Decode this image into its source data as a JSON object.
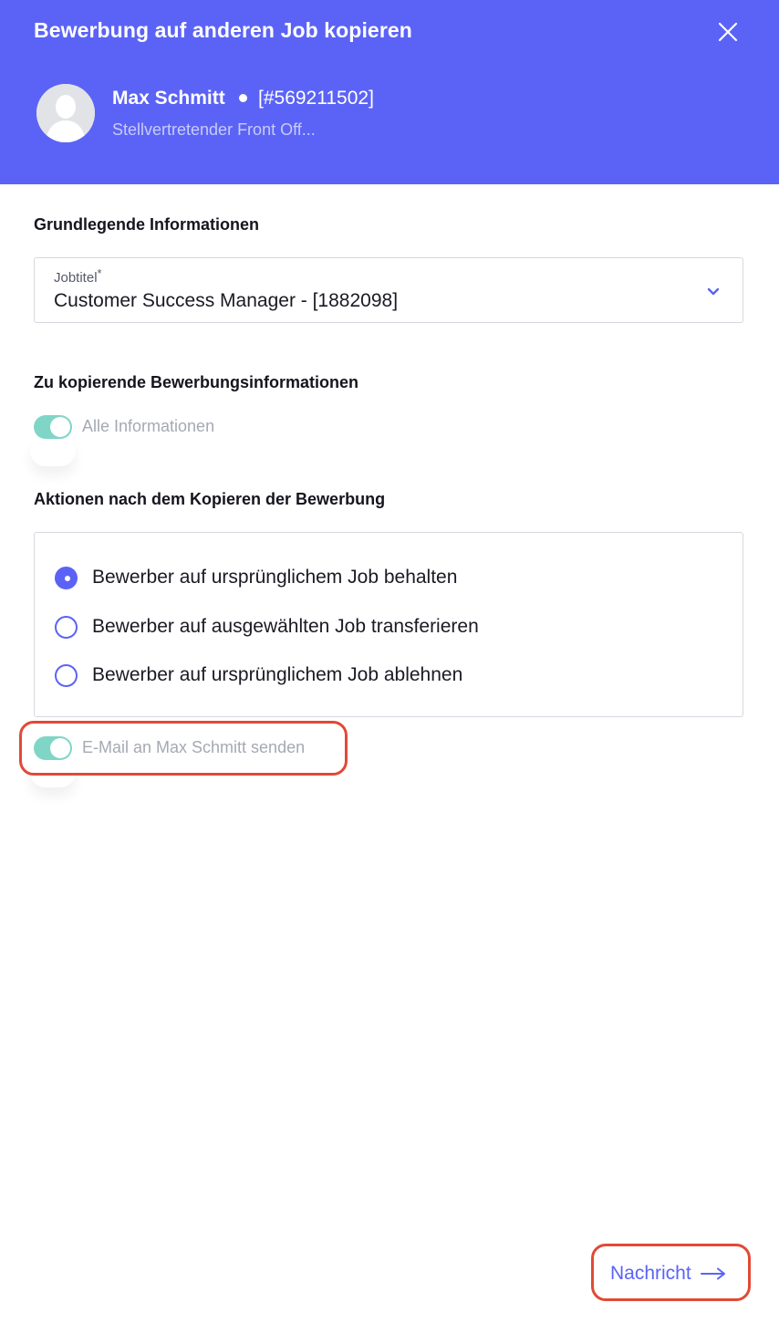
{
  "header": {
    "title": "Bewerbung auf anderen Job kopieren",
    "close_icon": "close-icon",
    "background": "#5b63f6"
  },
  "candidate": {
    "name": "Max Schmitt",
    "id": "[#569211502]",
    "subtitle": "Stellvertretender Front Off..."
  },
  "basic_info": {
    "title": "Grundlegende Informationen",
    "job_select": {
      "label": "Jobtitel",
      "required_mark": "*",
      "value": "Customer Success Manager - [1882098]"
    }
  },
  "copy_info": {
    "title": "Zu kopierende Bewerbungsinformationen",
    "toggle_label": "Alle Informationen",
    "toggle_on": true
  },
  "actions": {
    "title": "Aktionen nach dem Kopieren der Bewerbung",
    "options": [
      {
        "label": "Bewerber auf ursprünglichem Job behalten",
        "checked": true
      },
      {
        "label": "Bewerber auf ausgewählten Job transferieren",
        "checked": false
      },
      {
        "label": "Bewerber auf ursprünglichem Job ablehnen",
        "checked": false
      }
    ],
    "email_toggle_label": "E-Mail an Max Schmitt senden",
    "email_toggle_on": true
  },
  "footer": {
    "next_label": "Nachricht",
    "next_icon": "arrow-right-icon"
  },
  "colors": {
    "accent": "#5b63f6",
    "toggle": "#7fd6c6",
    "highlight": "#e04a35"
  }
}
